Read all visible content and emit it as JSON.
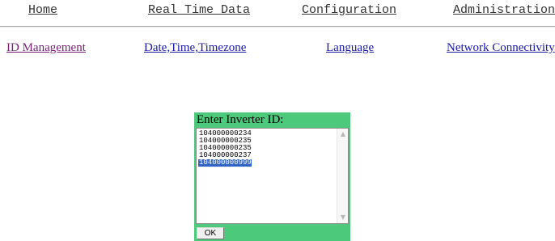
{
  "top_nav": {
    "home": "Home",
    "real_time_data": "Real Time Data",
    "configuration": "Configuration",
    "administration": "Administration"
  },
  "sub_nav": {
    "id_management": "ID Management",
    "date_time_timezone": "Date,Time,Timezone",
    "language": "Language",
    "network_connectivity": "Network Connectivity"
  },
  "inverter_panel": {
    "title": "Enter Inverter ID:",
    "ids": [
      "104000000234",
      "104000000235",
      "104000000235",
      "104000000237",
      "104000000999"
    ],
    "selected_id": "104000000999",
    "ok_label": "OK"
  },
  "colors": {
    "panel_green": "#4cc97a",
    "selection_blue": "#2f63c8",
    "visited_link": "#7a1e7a",
    "link": "#1a1aa6"
  }
}
